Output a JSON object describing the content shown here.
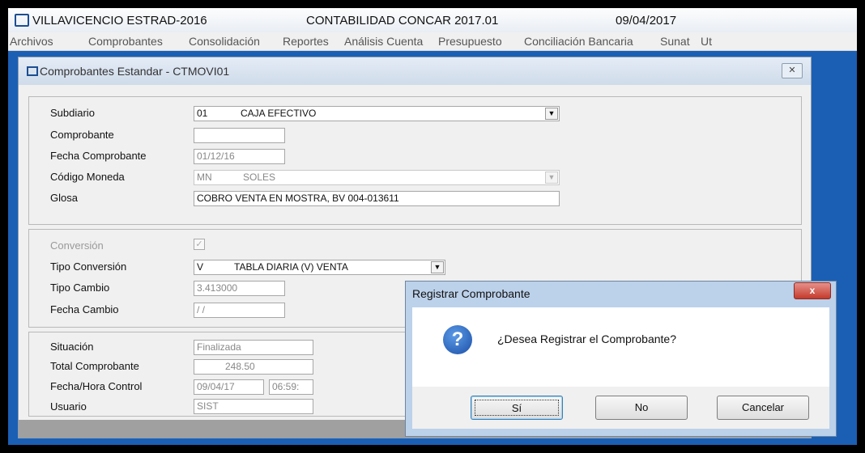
{
  "titlebar": {
    "company": "VILLAVICENCIO ESTRAD-2016",
    "app": "CONTABILIDAD CONCAR 2017.01",
    "date": "09/04/2017"
  },
  "menu": [
    "Archivos",
    "Comprobantes",
    "Consolidación",
    "Reportes",
    "Análisis Cuenta",
    "Presupuesto",
    "Conciliación Bancaria",
    "Sunat",
    "Ut"
  ],
  "window": {
    "title": "Comprobantes Estandar - CTMOVI01"
  },
  "section1": {
    "subdiario": {
      "label": "Subdiario",
      "code": "01",
      "name": "CAJA EFECTIVO"
    },
    "comprobante": {
      "label": "Comprobante",
      "value": ""
    },
    "fecha_comprobante": {
      "label": "Fecha Comprobante",
      "value": "01/12/16"
    },
    "codigo_moneda": {
      "label": "Código Moneda",
      "code": "MN",
      "name": "SOLES"
    },
    "glosa": {
      "label": "Glosa",
      "value": "COBRO VENTA EN MOSTRA, BV 004-013611"
    }
  },
  "section2": {
    "conversion": {
      "label": "Conversión",
      "checked": true
    },
    "tipo_conversion": {
      "label": "Tipo Conversión",
      "code": "V",
      "name": "TABLA DIARIA (V) VENTA"
    },
    "tipo_cambio": {
      "label": "Tipo Cambio",
      "value": "3.413000"
    },
    "fecha_cambio": {
      "label": "Fecha Cambio",
      "value": "/ /"
    }
  },
  "section3": {
    "situacion": {
      "label": "Situación",
      "value": "Finalizada"
    },
    "total": {
      "label": "Total Comprobante",
      "value": "248.50"
    },
    "fecha_hora": {
      "label": "Fecha/Hora Control",
      "date": "09/04/17",
      "time": "06:59:"
    },
    "usuario": {
      "label": "Usuario",
      "value": "SIST"
    }
  },
  "dialog": {
    "title": "Registrar Comprobante",
    "close_glyph": "x",
    "message": "¿Desea Registrar el Comprobante?",
    "icon_glyph": "?",
    "buttons": {
      "yes": "Sí",
      "no": "No",
      "cancel": "Cancelar"
    }
  }
}
